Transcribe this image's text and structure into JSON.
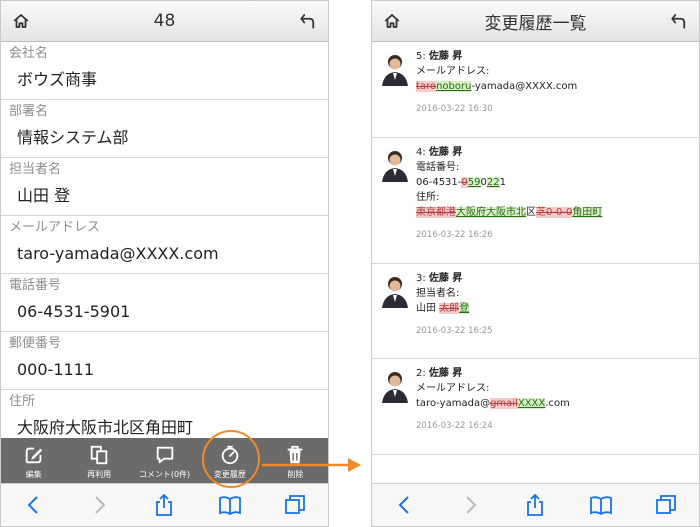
{
  "left": {
    "header_title": "48",
    "fields": [
      {
        "label": "会社名",
        "value": "ボウズ商事"
      },
      {
        "label": "部署名",
        "value": "情報システム部"
      },
      {
        "label": "担当者名",
        "value": "山田 登"
      },
      {
        "label": "メールアドレス",
        "value": "taro-yamada@XXXX.com"
      },
      {
        "label": "電話番号",
        "value": "06-4531-5901"
      },
      {
        "label": "郵便番号",
        "value": "000-1111"
      },
      {
        "label": "住所",
        "value": "大阪府大阪市北区角田町"
      }
    ],
    "toolbar": {
      "edit": "編集",
      "reuse": "再利用",
      "comment": "コメント(0件)",
      "history": "変更履歴",
      "delete": "削除"
    }
  },
  "right": {
    "header_title": "変更履歴一覧",
    "entries": [
      {
        "number": "5:",
        "user": "佐藤 昇",
        "field1": "メールアドレス:",
        "line1": {
          "del": "taro",
          "ins": "noboru",
          "rest": "-yamada@XXXX.com"
        },
        "time": "2016-03-22 16:30"
      },
      {
        "number": "4:",
        "user": "佐藤 昇",
        "field1": "電話番号:",
        "line1": {
          "pre": "06-4531-",
          "del": "0",
          "ins": "59",
          "mid": "0",
          "ins2": "22",
          "post": "1"
        },
        "field2": "住所:",
        "line2": {
          "del": "東京都港",
          "ins": "大阪府大阪市北",
          "mid": "区",
          "del2": "芝0-0-0",
          "ins2": "角田町"
        },
        "time": "2016-03-22 16:26"
      },
      {
        "number": "3:",
        "user": "佐藤 昇",
        "field1": "担当者名:",
        "line1": {
          "pre": "山田 ",
          "del": "太郎",
          "ins": "登"
        },
        "time": "2016-03-22 16:25"
      },
      {
        "number": "2:",
        "user": "佐藤 昇",
        "field1": "メールアドレス:",
        "line1": {
          "pre": "taro-yamada@",
          "del": "gmail",
          "ins": "XXXX",
          "post": ".com"
        },
        "time": "2016-03-22 16:24"
      }
    ]
  },
  "colors": {
    "accent_ring": "#f08a2a",
    "toolbar_bg": "#6b6b6b",
    "safari_blue": "#1a73e8"
  },
  "icons": [
    "home-icon",
    "back-icon",
    "edit-icon",
    "copy-icon",
    "comment-icon",
    "history-icon",
    "trash-icon",
    "safari-back-icon",
    "safari-forward-icon",
    "share-icon",
    "bookmarks-icon",
    "tabs-icon"
  ]
}
